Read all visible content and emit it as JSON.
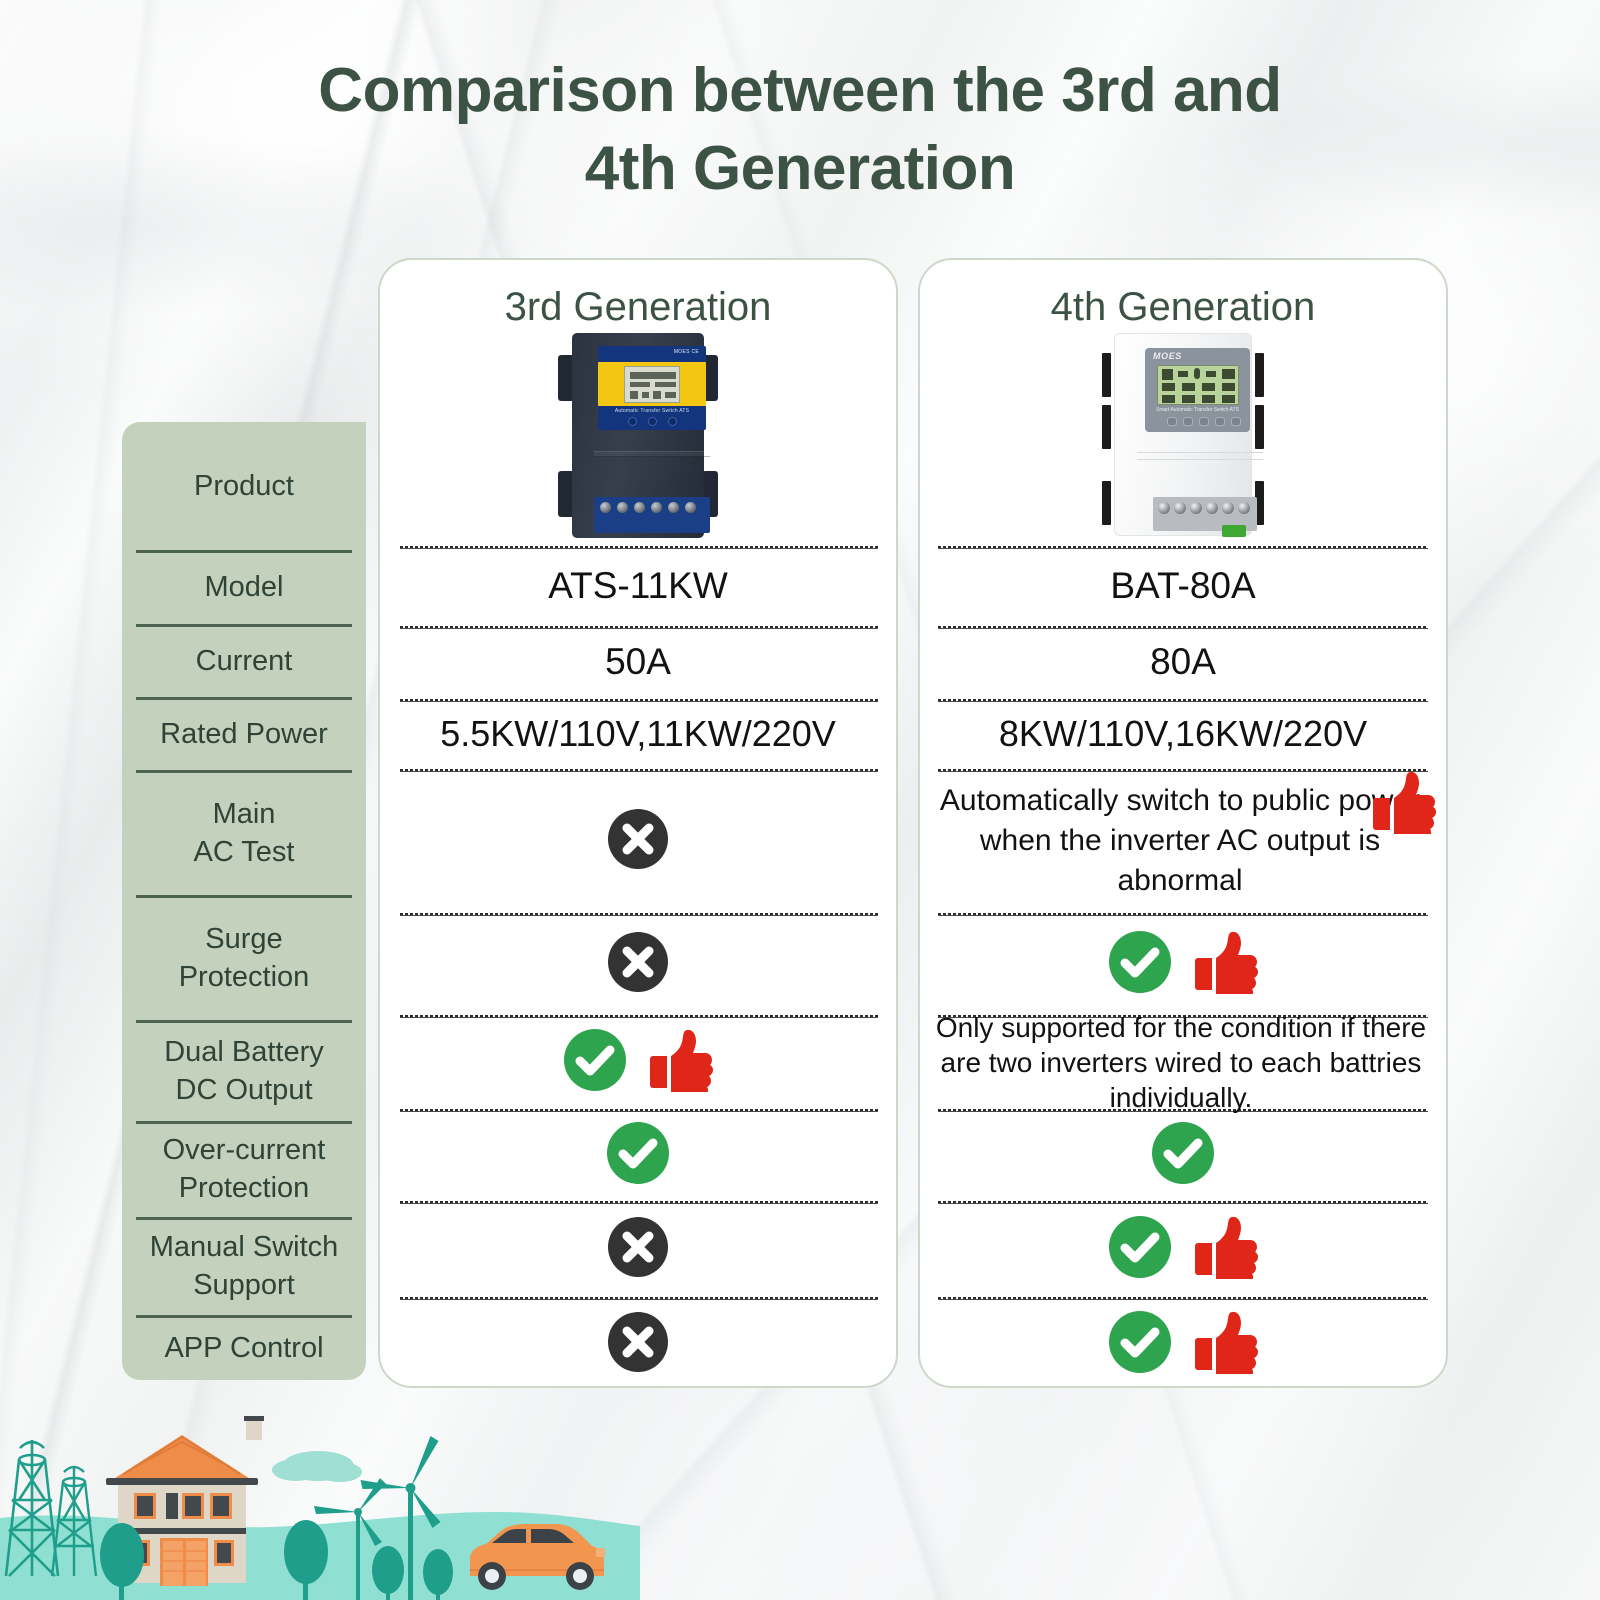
{
  "title": {
    "line1": "Comparison between the 3rd and",
    "line2": "4th Generation"
  },
  "colors": {
    "title_green": "#3c5245",
    "sidebar_bg": "#c3d1bd",
    "sidebar_text": "#2f4436",
    "card_border": "#cdd8c9",
    "check_green": "#2ea44f",
    "cross_dark": "#333333",
    "thumb_red": "#e02519",
    "background": "#f2f3f3"
  },
  "columns": [
    {
      "id": "gen3",
      "header": "3rd Generation",
      "product_icon": "ats-device-3rd-gen-black"
    },
    {
      "id": "gen4",
      "header": "4th Generation",
      "product_icon": "ats-device-4th-gen-white"
    }
  ],
  "rows": [
    {
      "label": "Product",
      "gen3": {
        "type": "image",
        "icon": "ats-device-3rd-gen-black"
      },
      "gen4": {
        "type": "image",
        "icon": "ats-device-4th-gen-white"
      }
    },
    {
      "label": "Model",
      "gen3": {
        "type": "text",
        "value": "ATS-11KW"
      },
      "gen4": {
        "type": "text",
        "value": "BAT-80A"
      }
    },
    {
      "label": "Current",
      "gen3": {
        "type": "text",
        "value": "50A"
      },
      "gen4": {
        "type": "text",
        "value": "80A"
      }
    },
    {
      "label": "Rated Power",
      "gen3": {
        "type": "text",
        "value": "5.5KW/110V,11KW/220V"
      },
      "gen4": {
        "type": "text",
        "value": "8KW/110V,16KW/220V"
      }
    },
    {
      "label": "Main\nAC Test",
      "label_l1": "Main",
      "label_l2": "AC Test",
      "gen3": {
        "type": "icons",
        "icons": [
          "cross-icon"
        ]
      },
      "gen4": {
        "type": "note",
        "value": "Automatically switch to public power when the inverter AC output is abnormal",
        "icons": [
          "thumbs-up-icon"
        ]
      }
    },
    {
      "label": "Surge\nProtection",
      "label_l1": "Surge",
      "label_l2": "Protection",
      "gen3": {
        "type": "icons",
        "icons": [
          "cross-icon"
        ]
      },
      "gen4": {
        "type": "icons",
        "icons": [
          "check-icon",
          "thumbs-up-icon"
        ]
      }
    },
    {
      "label": "Dual Battery\nDC Output",
      "label_l1": "Dual Battery",
      "label_l2": "DC Output",
      "gen3": {
        "type": "icons",
        "icons": [
          "check-icon",
          "thumbs-up-icon"
        ]
      },
      "gen4": {
        "type": "note",
        "value": "Only supported for the condition if there are two inverters wired to each battries individually."
      }
    },
    {
      "label": "Over-current\nProtection",
      "label_l1": "Over-current",
      "label_l2": "Protection",
      "gen3": {
        "type": "icons",
        "icons": [
          "check-icon"
        ]
      },
      "gen4": {
        "type": "icons",
        "icons": [
          "check-icon"
        ]
      }
    },
    {
      "label": "Manual Switch\nSupport",
      "label_l1": "Manual Switch",
      "label_l2": "Support",
      "gen3": {
        "type": "icons",
        "icons": [
          "cross-icon"
        ]
      },
      "gen4": {
        "type": "icons",
        "icons": [
          "check-icon",
          "thumbs-up-icon"
        ]
      }
    },
    {
      "label": "APP Control",
      "gen3": {
        "type": "icons",
        "icons": [
          "cross-icon"
        ]
      },
      "gen4": {
        "type": "icons",
        "icons": [
          "check-icon",
          "thumbs-up-icon"
        ]
      }
    }
  ],
  "device_gen3": {
    "brand": "MOES CE",
    "subtitle": "Automatic Transfer Switch ATS"
  },
  "device_gen4": {
    "brand": "MOES",
    "subtitle": "Smart Automatic Transfer Switch ATS"
  },
  "illustration": {
    "elements": [
      "power-pylon",
      "house",
      "tree",
      "wind-turbine",
      "car"
    ],
    "ground_color": "#8fe0d2",
    "roof_color": "#f08c4a",
    "wall_color": "#ded6c6",
    "teal": "#1f9e8c",
    "car_color": "#f2954f"
  }
}
